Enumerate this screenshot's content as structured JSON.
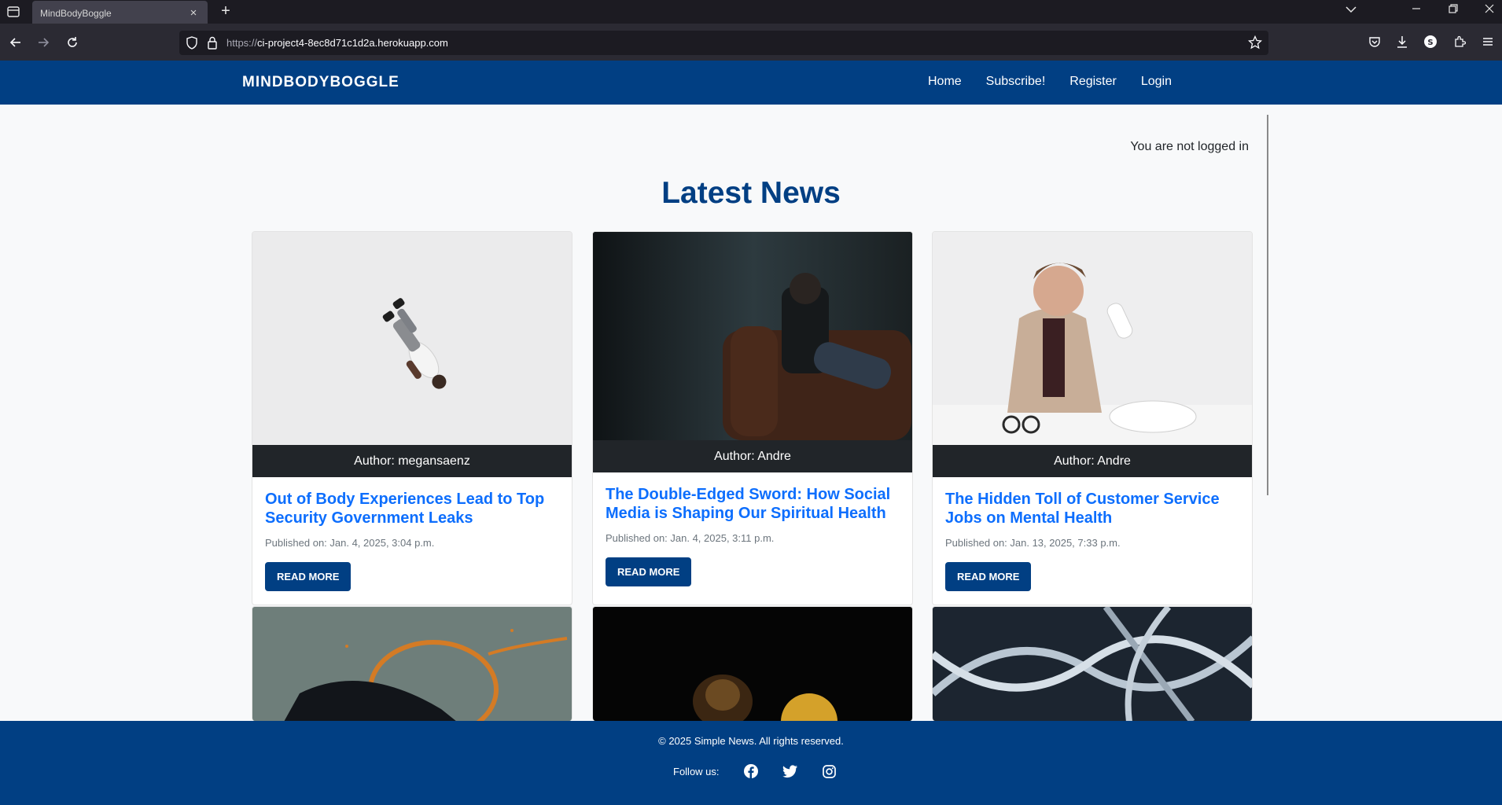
{
  "browser": {
    "tab_title": "MindBodyBoggle",
    "tab_close": "×",
    "new_tab": "+",
    "url_scheme": "https://",
    "url_host": "ci-project4-8ec8d71c1d2a.herokuapp.com"
  },
  "header": {
    "brand": "MINDBODYBOGGLE",
    "nav": [
      "Home",
      "Subscribe!",
      "Register",
      "Login"
    ]
  },
  "status": {
    "login_text": "You are not logged in"
  },
  "main": {
    "title": "Latest News",
    "read_more_label": "Read More",
    "cards": [
      {
        "author": "Author: megansaenz",
        "title": "Out of Body Experiences Lead to Top Security Government Leaks",
        "date": "Published on: Jan. 4, 2025, 3:04 p.m."
      },
      {
        "author": "Author: Andre",
        "title": "The Double-Edged Sword: How Social Media is Shaping Our Spiritual Health",
        "date": "Published on: Jan. 4, 2025, 3:11 p.m."
      },
      {
        "author": "Author: Andre",
        "title": "The Hidden Toll of Customer Service Jobs on Mental Health",
        "date": "Published on: Jan. 13, 2025, 7:33 p.m."
      }
    ]
  },
  "footer": {
    "copyright": "© 2025 Simple News. All rights reserved.",
    "follow_label": "Follow us:"
  },
  "colors": {
    "brand_blue": "#013f83",
    "link_blue": "#0d6efd",
    "author_bar": "#212529"
  },
  "icons": [
    "facebook-icon",
    "twitter-icon",
    "instagram-icon"
  ]
}
